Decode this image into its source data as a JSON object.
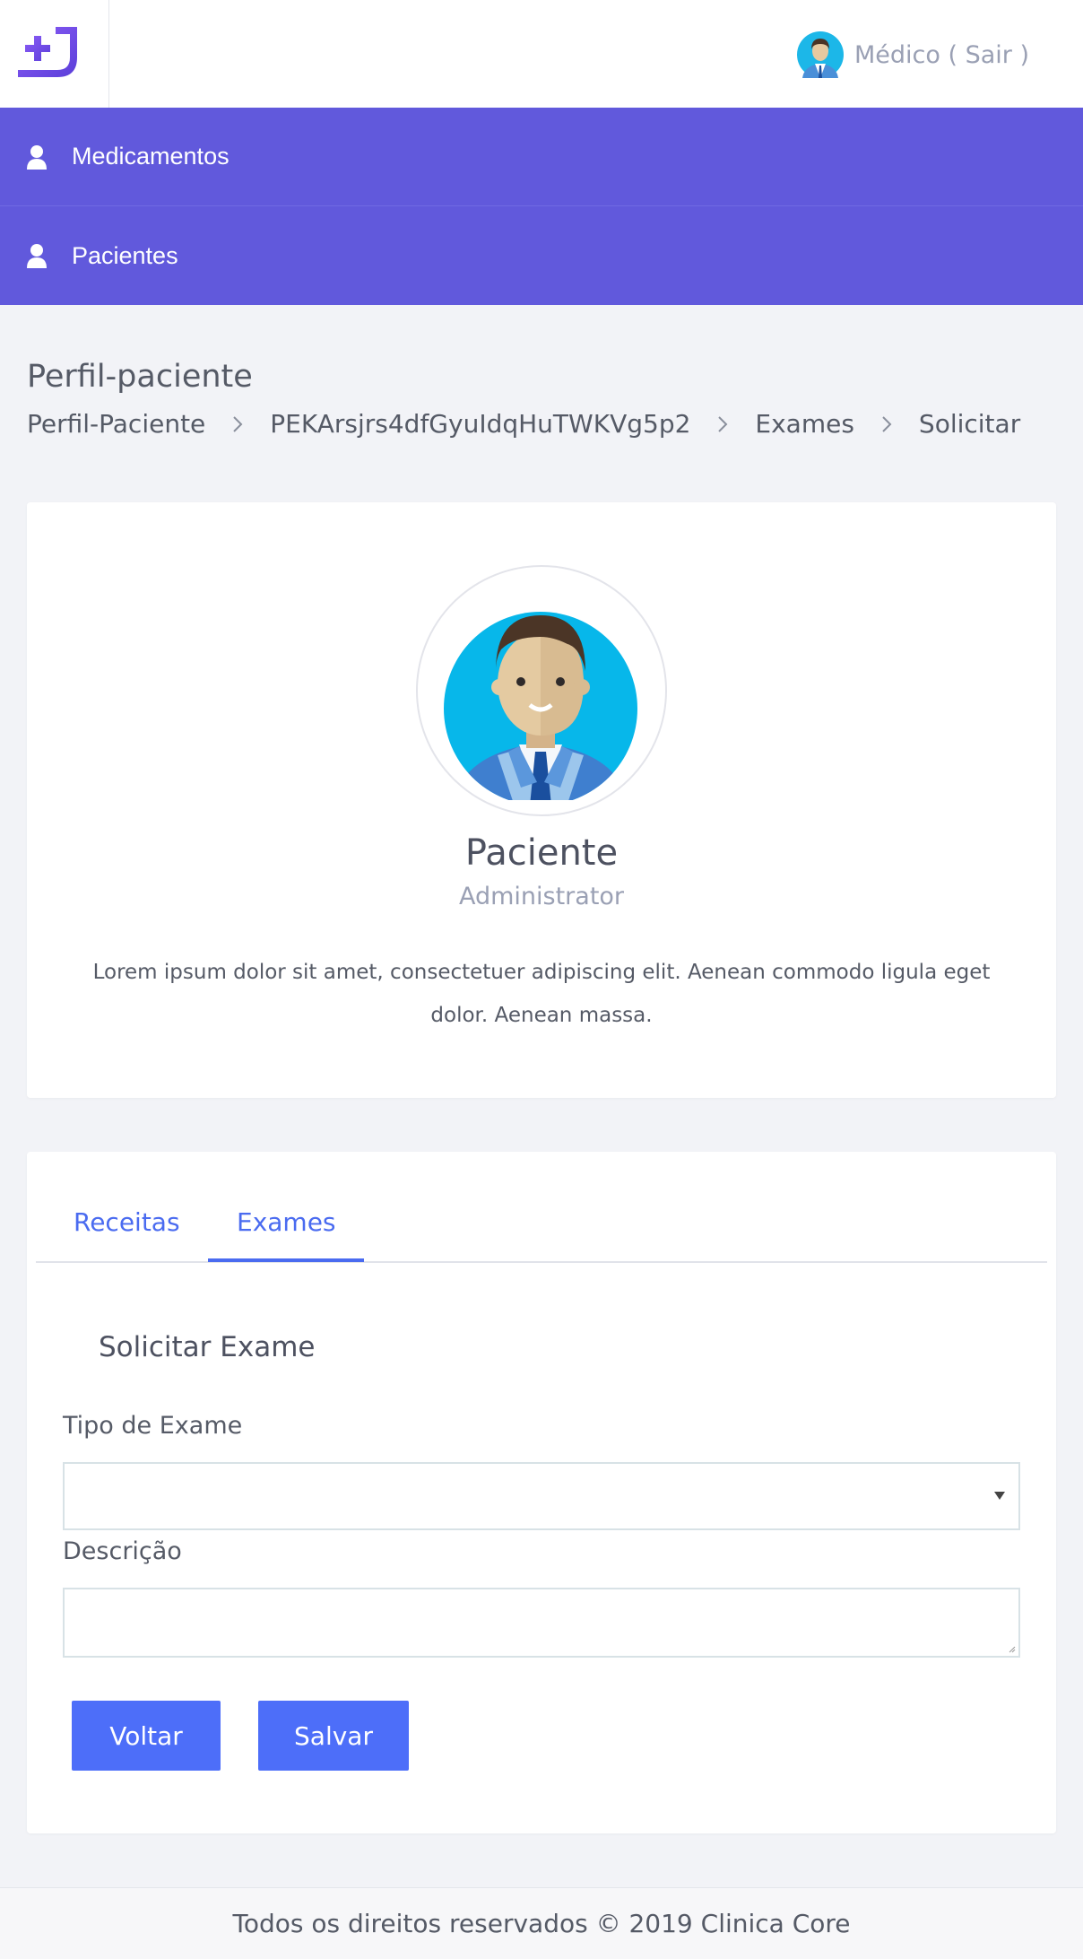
{
  "header": {
    "logo_icon": "plus-j-logo",
    "user_label": "Médico ( Sair )",
    "user_avatar_icon": "doctor-avatar-icon"
  },
  "sidebar": {
    "items": [
      {
        "label": "Medicamentos",
        "icon": "user-icon"
      },
      {
        "label": "Pacientes",
        "icon": "user-icon"
      }
    ]
  },
  "page": {
    "title": "Perfil-paciente",
    "breadcrumb": [
      "Perfil-Paciente",
      "PEKArsjrs4dfGyuIdqHuTWKVg5p2",
      "Exames",
      "Solicitar"
    ]
  },
  "profile": {
    "name": "Paciente",
    "role": "Administrator",
    "bio": "Lorem ipsum dolor sit amet, consectetuer adipiscing elit. Aenean commodo ligula eget dolor. Aenean massa."
  },
  "tabs": [
    {
      "label": "Receitas",
      "active": false
    },
    {
      "label": "Exames",
      "active": true
    }
  ],
  "form": {
    "title": "Solicitar Exame",
    "exam_type_label": "Tipo de Exame",
    "exam_type_value": "",
    "description_label": "Descrição",
    "description_value": "",
    "back_button": "Voltar",
    "save_button": "Salvar"
  },
  "footer": {
    "text": "Todos os direitos reservados © 2019 Clinica Core"
  },
  "colors": {
    "nav_background": "#6159dc",
    "accent": "#4a6bf0",
    "button": "#4d6ef9",
    "page_background": "#f2f3f7"
  }
}
